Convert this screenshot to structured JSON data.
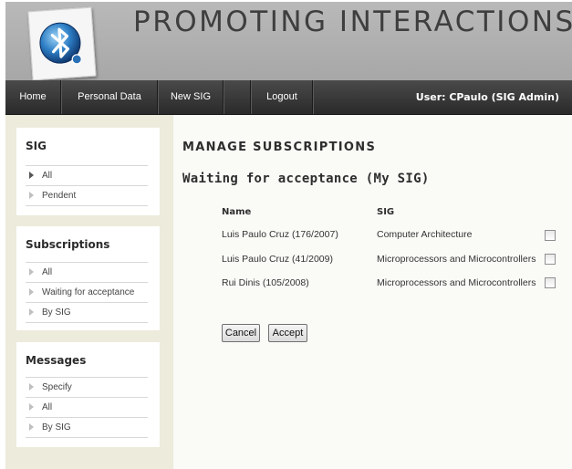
{
  "header": {
    "site_title": "PROMOTING INTERACTIONS",
    "logo_icon": "bluetooth-globe-icon"
  },
  "nav": {
    "items": [
      {
        "label": "Home"
      },
      {
        "label": "Personal Data"
      },
      {
        "label": "New SIG"
      },
      {
        "label": ""
      },
      {
        "label": "Logout"
      }
    ],
    "user": "User: CPaulo (SIG Admin)"
  },
  "sidebar": {
    "sig": {
      "title": "SIG",
      "items": [
        {
          "label": "All"
        },
        {
          "label": "Pendent"
        }
      ]
    },
    "subscriptions": {
      "title": "Subscriptions",
      "items": [
        {
          "label": "All"
        },
        {
          "label": "Waiting for acceptance"
        },
        {
          "label": "By SIG"
        }
      ]
    },
    "messages": {
      "title": "Messages",
      "items": [
        {
          "label": "Specify"
        },
        {
          "label": "All"
        },
        {
          "label": "By SIG"
        }
      ]
    }
  },
  "main": {
    "title": "MANAGE SUBSCRIPTIONS",
    "subtitle": "Waiting for acceptance (My SIG)",
    "columns": [
      "Name",
      "SIG"
    ],
    "rows": [
      {
        "name": "Luis Paulo Cruz (176/2007)",
        "sig": "Computer Architecture",
        "checked": false
      },
      {
        "name": "Luis Paulo Cruz (41/2009)",
        "sig": "Microprocessors and Microcontrollers",
        "checked": false
      },
      {
        "name": "Rui Dinis (105/2008)",
        "sig": "Microprocessors and Microcontrollers",
        "checked": false
      }
    ],
    "cancel_label": "Cancel",
    "accept_label": "Accept"
  }
}
